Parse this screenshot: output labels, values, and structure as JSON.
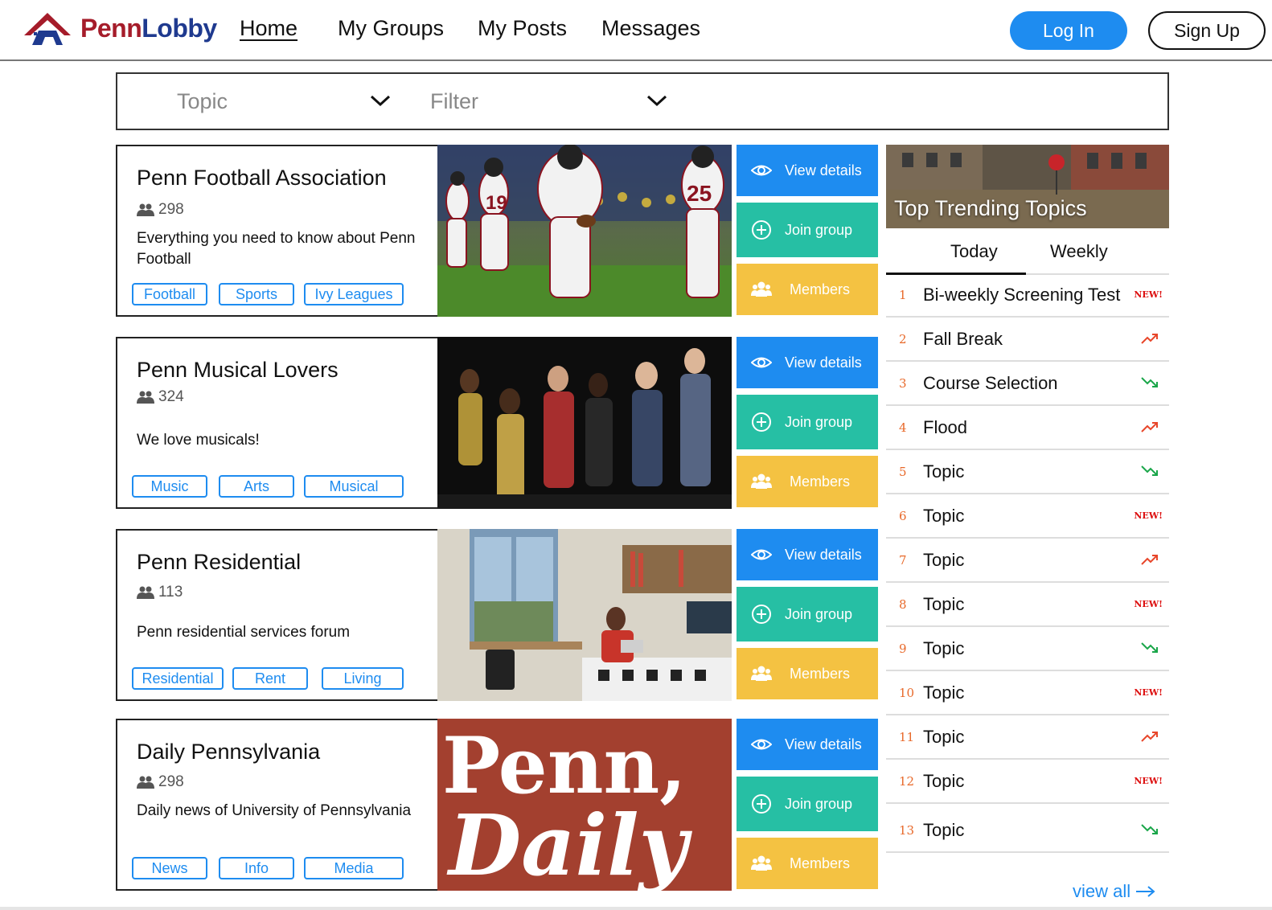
{
  "brand": {
    "part1": "Penn",
    "part2": "Lobby",
    "colors": {
      "red": "#a51c2a",
      "blue": "#1f3a8f"
    }
  },
  "nav": {
    "home": "Home",
    "groups": "My Groups",
    "posts": "My Posts",
    "messages": "Messages"
  },
  "auth": {
    "login": "Log In",
    "signup": "Sign Up"
  },
  "filters": {
    "topic": "Topic",
    "filter": "Filter"
  },
  "actions": {
    "view": "View details",
    "join": "Join group",
    "members": "Members"
  },
  "groups": [
    {
      "title": "Penn Football Association",
      "count": "298",
      "desc": "Everything you need to know about Penn Football",
      "tags": [
        "Football",
        "Sports",
        "Ivy Leagues"
      ],
      "image": "football-players-photo"
    },
    {
      "title": "Penn Musical Lovers",
      "count": "324",
      "desc": "We love musicals!",
      "tags": [
        "Music",
        "Arts",
        "Musical"
      ],
      "image": "musical-performers-photo"
    },
    {
      "title": "Penn Residential",
      "count": "113",
      "desc": "Penn residential services forum",
      "tags": [
        "Residential",
        "Rent",
        "Living"
      ],
      "image": "dorm-room-photo"
    },
    {
      "title": "Daily Pennsylvania",
      "count": "298",
      "desc": "Daily news of University of Pennsylvania",
      "tags": [
        "News",
        "Info",
        "Media"
      ],
      "image": "daily-pennsylvania-logo",
      "logo_text": {
        "line1": "Penn,",
        "line2": "Daily"
      }
    }
  ],
  "trending": {
    "title": "Top Trending Topics",
    "tabs": [
      "Today",
      "Weekly"
    ],
    "active_tab": "Today",
    "badge_text": "NEW!",
    "items": [
      {
        "rank": "1",
        "label": "Bi-weekly Screening Test",
        "status": "new"
      },
      {
        "rank": "2",
        "label": "Fall Break",
        "status": "up"
      },
      {
        "rank": "3",
        "label": "Course Selection",
        "status": "down"
      },
      {
        "rank": "4",
        "label": "Flood",
        "status": "up"
      },
      {
        "rank": "5",
        "label": "Topic",
        "status": "down"
      },
      {
        "rank": "6",
        "label": "Topic",
        "status": "new"
      },
      {
        "rank": "7",
        "label": "Topic",
        "status": "up"
      },
      {
        "rank": "8",
        "label": "Topic",
        "status": "new"
      },
      {
        "rank": "9",
        "label": "Topic",
        "status": "down"
      },
      {
        "rank": "10",
        "label": "Topic",
        "status": "new"
      },
      {
        "rank": "11",
        "label": "Topic",
        "status": "up"
      },
      {
        "rank": "12",
        "label": "Topic",
        "status": "new"
      },
      {
        "rank": "13",
        "label": "Topic",
        "status": "down"
      }
    ],
    "view_all": "view all"
  },
  "colors": {
    "accent": "#1e8cf0",
    "join": "#26bfa4",
    "members": "#f4c242",
    "rank": "#e8692a",
    "up": "#e8462a",
    "down": "#1aa64a",
    "new": "#d11"
  }
}
